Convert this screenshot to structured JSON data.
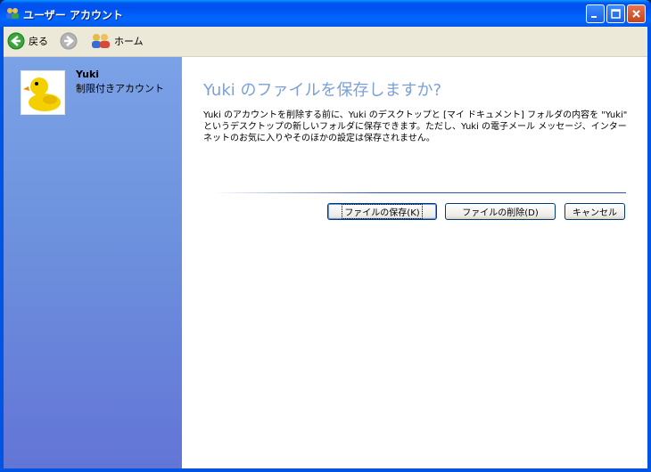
{
  "window": {
    "title": "ユーザー アカウント"
  },
  "toolbar": {
    "back_label": "戻る",
    "home_label": "ホーム"
  },
  "sidebar": {
    "user_name": "Yuki",
    "account_type": "制限付きアカウント"
  },
  "main": {
    "heading": "Yuki のファイルを保存しますか?",
    "description": "Yuki のアカウントを削除する前に、Yuki のデスクトップと [マイ ドキュメント] フォルダの内容を \"Yuki\" というデスクトップの新しいフォルダに保存できます。ただし、Yuki の電子メール メッセージ、インターネットのお気に入りやそのほかの設定は保存されません。",
    "buttons": {
      "save": "ファイルの保存(K)",
      "delete": "ファイルの削除(D)",
      "cancel": "キャンセル"
    }
  },
  "colors": {
    "titlebar": "#0058ee",
    "heading": "#7ba0d8",
    "sidebar_top": "#7ba2e7",
    "sidebar_bottom": "#6375d6"
  }
}
